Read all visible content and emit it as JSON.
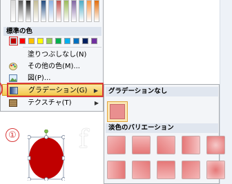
{
  "colors": {
    "theme_shades": [
      "#d9d9d9",
      "#595959",
      "#1f1f1f",
      "#c4bd97",
      "#1f497d",
      "#8db3e2",
      "#c0504d",
      "#9bbb59",
      "#8064a2",
      "#4bacc6",
      "#f79646",
      "#e36c09"
    ],
    "standard": [
      "#c00000",
      "#ff0000",
      "#ffc000",
      "#ffff00",
      "#92d050",
      "#00b050",
      "#00b0f0",
      "#0070c0",
      "#002060",
      "#7030a0"
    ],
    "shape_fill": "#c00000",
    "highlight_border": "#d83a3a"
  },
  "menu": {
    "standard_colors_header": "標準の色",
    "no_fill": "塗りつぶしなし(N)",
    "more_colors": "その他の色(M)...",
    "picture": "図(P)...",
    "gradient": "グラデーション(G)",
    "texture": "テクスチャ(T)",
    "arrow": "▶"
  },
  "submenu": {
    "no_gradient": "グラデーションなし",
    "light_variations": "淡色のバリエーション"
  },
  "annotation": {
    "step": "①",
    "cursor_glyph": "f"
  }
}
